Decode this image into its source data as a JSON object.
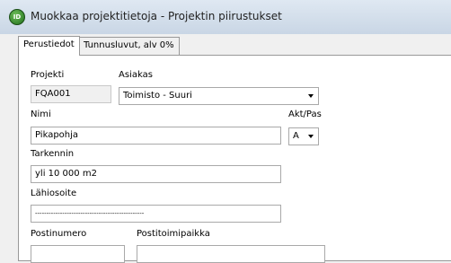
{
  "window": {
    "title": "Muokkaa projektitietoja - Projektin piirustukset",
    "icon": "app-logo-icon"
  },
  "tabs": [
    {
      "label": "Perustiedot",
      "active": true
    },
    {
      "label": "Tunnusluvut, alv 0%",
      "active": false
    }
  ],
  "form": {
    "projekti": {
      "label": "Projekti",
      "value": "FQA001"
    },
    "asiakas": {
      "label": "Asiakas",
      "value": "Toimisto - Suuri"
    },
    "nimi": {
      "label": "Nimi",
      "value": "Pikapohja"
    },
    "aktpas": {
      "label": "Akt/Pas",
      "value": "A"
    },
    "tarkennin": {
      "label": "Tarkennin",
      "value": "yli 10 000 m2"
    },
    "lahiosoite": {
      "label": "Lähiosoite",
      "value": "------------------------------------------------"
    },
    "postinumero": {
      "label": "Postinumero",
      "value": ""
    },
    "postitoimipaikka": {
      "label": "Postitoimipaikka",
      "value": ""
    }
  },
  "colors": {
    "titlebar": "#d4dfec",
    "panel": "#ffffff",
    "readonly_field": "#f0f0f0"
  }
}
